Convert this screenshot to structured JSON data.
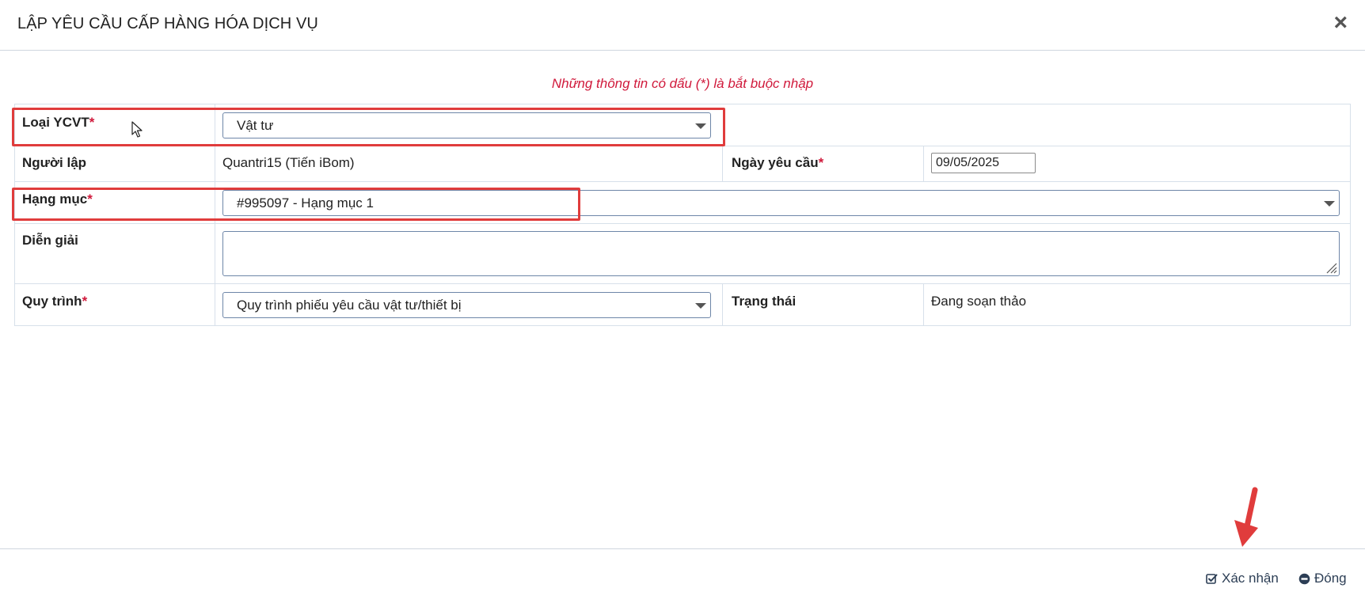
{
  "dialog": {
    "title": "LẬP YÊU CẦU CẤP HÀNG HÓA DỊCH VỤ",
    "close_symbol": "×"
  },
  "required_note": "Những thông tin có dấu (*) là bắt buộc nhập",
  "required_marker": "*",
  "form": {
    "loai_ycvt": {
      "label": "Loại YCVT",
      "value": "Vật tư"
    },
    "nguoi_lap": {
      "label": "Người lập",
      "value": "Quantri15 (Tiến iBom)"
    },
    "ngay_yeu_cau": {
      "label": "Ngày yêu cầu",
      "value": "09/05/2025"
    },
    "hang_muc": {
      "label": "Hạng mục",
      "value": "#995097 - Hạng mục 1"
    },
    "dien_giai": {
      "label": "Diễn giải",
      "value": ""
    },
    "quy_trinh": {
      "label": "Quy trình",
      "value": "Quy trình phiếu yêu cầu vật tư/thiết bị"
    },
    "trang_thai": {
      "label": "Trạng thái",
      "value": "Đang soạn thảo"
    }
  },
  "footer": {
    "confirm_label": "Xác nhận",
    "close_label": "Đóng"
  },
  "colors": {
    "required": "#d0193b",
    "highlight": "#e03c3c",
    "border": "#d7e0ea"
  }
}
